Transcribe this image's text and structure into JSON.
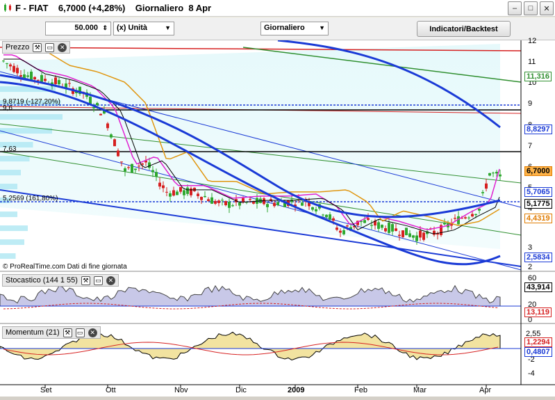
{
  "window": {
    "title": "F - FIAT    6,7000 (+4,28%)    Giornaliero  8 Apr",
    "min_label": "–",
    "max_label": "□",
    "close_label": "✕"
  },
  "toolbar": {
    "quantity_value": "50.000",
    "unit_value": "(x) Unità",
    "period_value": "Giornaliero",
    "indicators_label": "Indicatori/Backtest"
  },
  "panes": {
    "price": {
      "title": "Prezzo",
      "y_ticks": [
        "12",
        "11",
        "10",
        "9",
        "8",
        "7",
        "6",
        "5",
        "4",
        "3",
        "2"
      ],
      "tags": [
        {
          "text": "11,316",
          "color": "#2f8f2f"
        },
        {
          "text": "8,8297",
          "color": "#1a3ad6"
        },
        {
          "text": "6,7000",
          "color": "#e07b00",
          "bg": "#ffb347"
        },
        {
          "text": "5,7065",
          "color": "#1a3ad6"
        },
        {
          "text": "5,1775",
          "color": "#000000"
        },
        {
          "text": "4,4319",
          "color": "#e07b00"
        },
        {
          "text": "2,5834",
          "color": "#1a3ad6"
        }
      ],
      "annotations": [
        "9,8719 (-127,20%)",
        "9,6",
        "7,63",
        "5,2569 (161,80%)"
      ],
      "credit": "© ProRealTime.com  Dati di fine giornata"
    },
    "stochastic": {
      "title": "Stocastico (144 1 55)",
      "y_ticks": [
        "60",
        "20",
        "0"
      ],
      "tags": [
        {
          "text": "43,914",
          "color": "#000000"
        },
        {
          "text": "13,119",
          "color": "#d62020"
        }
      ]
    },
    "momentum": {
      "title": "Momentum (21)",
      "y_ticks": [
        "2,55",
        "-2",
        "-4"
      ],
      "tags": [
        {
          "text": "1,2294",
          "color": "#d62020"
        },
        {
          "text": "0,4807",
          "color": "#1a3ad6"
        }
      ]
    }
  },
  "x_axis": {
    "months": [
      "Set",
      "Ott",
      "Nov",
      "Dic",
      "2009",
      "Feb",
      "Mar",
      "Apr"
    ]
  },
  "colors": {
    "up_candle": "#2fa82f",
    "down_candle": "#d62020",
    "ma_blue": "#1a3ad6",
    "ma_orange": "#e0960f",
    "ma_magenta": "#e020d0",
    "ma_black": "#000000",
    "trend_red": "#d62020",
    "trend_green": "#2f8f2f"
  },
  "icons": {
    "settings": "wrench-icon",
    "window": "window-icon",
    "close": "close-icon"
  }
}
